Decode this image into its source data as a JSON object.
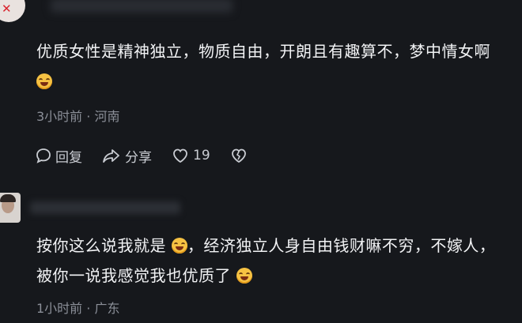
{
  "comments": [
    {
      "text_part1": "优质女性是精神独立，物质自由，开朗且有趣算不，梦中情女啊",
      "text_part2": "",
      "time": "3小时前",
      "location": "河南"
    },
    {
      "text_part1": "按你这么说我就是",
      "text_part2": "，经济独立人身自由钱财嘛不穷，不嫁人，被你一说我感觉我也优质了",
      "time": "1小时前",
      "location": "广东"
    }
  ],
  "actions": {
    "reply_label": "回复",
    "share_label": "分享",
    "like_count": "19"
  },
  "meta_separator": "·",
  "icons": [
    "chat-bubble-icon",
    "share-arrow-icon",
    "heart-icon",
    "broken-heart-icon",
    "laugh-emoji-icon"
  ],
  "colors": {
    "background": "#16181c",
    "text": "#f2f3f5",
    "meta": "#8b8f98",
    "action": "#c9ccd2"
  }
}
